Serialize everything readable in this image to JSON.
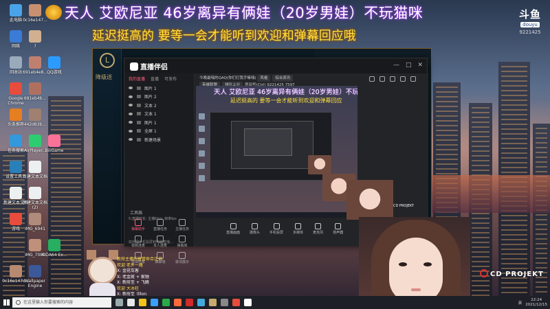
{
  "overlay": {
    "title": "天人 艾欧尼亚 46岁离异有俩娃（20岁男娃）不玩猫咪",
    "subtitle": "延迟挺高的 要等一会才能听到欢迎和弹幕回应哦",
    "logo_main": "斗鱼",
    "logo_sub": "douyu",
    "room_id": "9221425"
  },
  "desktop_icons": [
    {
      "label": "此电脑",
      "color": "#4aa3e8"
    },
    {
      "label": "0c16e147...",
      "color": "#c89070"
    },
    {
      "label": "网络",
      "color": "#3a7bd5"
    },
    {
      "label": "7",
      "color": "#d0b090"
    },
    {
      "label": "回收站",
      "color": "#9ab"
    },
    {
      "label": "691eb4e8...",
      "color": "#c08070"
    },
    {
      "label": "QQ游戏",
      "color": "#2b9bff"
    },
    {
      "label": "Google Chrome",
      "color": "#e74c3c"
    },
    {
      "label": "691eb4b...",
      "color": "#b07060"
    },
    {
      "label": "头条推荐",
      "color": "#e67e22"
    },
    {
      "label": "442d63b...",
      "color": "#a08070"
    },
    {
      "label": "任务搜索",
      "color": "#3498db"
    },
    {
      "label": "AirPlayer...",
      "color": "#2ecc71"
    },
    {
      "label": "BiliGame",
      "color": "#fb7299"
    },
    {
      "label": "设置工具...",
      "color": "#2980b9"
    },
    {
      "label": "新建文本文档",
      "color": "#ecf0f1"
    },
    {
      "label": "新建文本文档(2)",
      "color": "#ecf0f1"
    },
    {
      "label": "新建文本文档",
      "color": "#ecf0f1"
    },
    {
      "label": "IMG_6941",
      "color": "#b08a7a"
    },
    {
      "label": "游戏",
      "color": "#e74c3c"
    },
    {
      "label": "IMG_7080",
      "color": "#c0907a"
    },
    {
      "label": "AIDA64 Ex...",
      "color": "#27ae60"
    },
    {
      "label": "0c16e147d...",
      "color": "#b88a70"
    },
    {
      "label": "Wallpaper Engine",
      "color": "#3b5998"
    }
  ],
  "lol_client": {
    "logo": "L",
    "side_label": "降级送"
  },
  "companion": {
    "app_name": "直播伴侣",
    "window_buttons": [
      "—",
      "□",
      "✕"
    ],
    "tabs": [
      "我的直播",
      "直播",
      "可发布"
    ],
    "scenes": [
      "图片 1",
      "图片 2",
      "文本 2",
      "文本 1",
      "图片 1",
      "全屏 1",
      "新建场景"
    ],
    "tools_title": "工具箱",
    "tools": [
      {
        "label": "弹幕助手",
        "hot": true
      },
      {
        "label": "直播任务",
        "hot": false
      },
      {
        "label": "主播任务",
        "hot": false
      },
      {
        "label": "视频连麦",
        "hot": false
      },
      {
        "label": "本人连麦",
        "hot": false
      },
      {
        "label": "弹幕库",
        "hot": false
      },
      {
        "label": "虚拟形象",
        "hot": false
      },
      {
        "label": "弹幕墙",
        "hot": false
      },
      {
        "label": "歌词展示",
        "hot": false
      }
    ],
    "feedback": "如何把手机投屏到电脑直播…",
    "info_line1": "今晚最嗨的QAQ(你们打我手嘛嗨)",
    "info_tag1": "风格",
    "info_tag2": "综合资讯",
    "info_line2_a": "英雄联盟",
    "info_line2_b": "排位上分",
    "info_line2_c": "房间号(Ctrl)",
    "room_id": "9221425",
    "online": "7597",
    "status": "5:直播时长: 主播Kb/s: 帧率fps",
    "controls": [
      "直播画面",
      "摄像头",
      "手机投屏",
      "多媒体",
      "麦克风",
      "扬声器"
    ],
    "preview_title": "天人 艾欧尼亚 46岁离异有俩娃（20岁男娃）不玩猫咪",
    "preview_subtitle": "延迟挺高的 要等一会才能听到欢迎和弹幕回应"
  },
  "chat": [
    {
      "text": "新府主播的直管命合注询",
      "color": "yellow"
    },
    {
      "text": "欢迎 老乡一路",
      "color": "yellow"
    },
    {
      "text": "X: 金花车客",
      "color": "white"
    },
    {
      "text": "X: 老金斑 + 家驰",
      "color": "white"
    },
    {
      "text": "X: 新府至 + 飞腾",
      "color": "white"
    },
    {
      "text": "欢迎 大冰柱",
      "color": "yellow"
    },
    {
      "text": "X: 新府至_llllon",
      "color": "white"
    },
    {
      "text": "X: 你 = 不是很谁清",
      "color": "white"
    }
  ],
  "cd_projekt": "CD PROJEKT",
  "taskbar": {
    "search_placeholder": "在这里输入你要搜索的内容",
    "time": "22:24",
    "date": "2021/12/15",
    "lang": "英",
    "app_colors": [
      "#9aa",
      "#e8e8e8",
      "#f2c31a",
      "#3aa0ff",
      "#2aa84a",
      "#ff6a3a",
      "#d02a2a",
      "#4ad",
      "#c8aa6e",
      "#888",
      "#e74c3c",
      "#fff"
    ]
  }
}
